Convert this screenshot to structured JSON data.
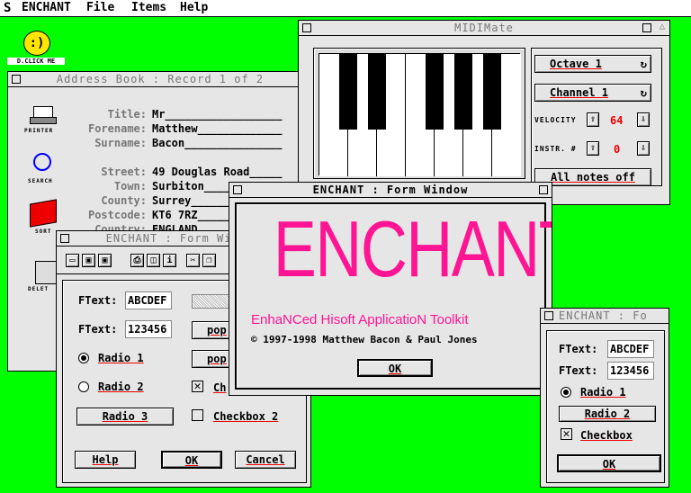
{
  "menubar": {
    "logo": "S",
    "app": "ENCHANT",
    "menus": [
      "File",
      "Items",
      "Help"
    ]
  },
  "desktop": {
    "dclick_label": "D.CLICK ME",
    "printer": "PRINTER",
    "search": "SEARCH",
    "sort": "SORT",
    "delete": "DELET"
  },
  "address_book": {
    "title": "Address Book : Record 1 of 2",
    "labels": [
      "Title:",
      "Forename:",
      "Surname:",
      "Street:",
      "Town:",
      "County:",
      "Postcode:",
      "Country:"
    ],
    "values": [
      "Mr__________________",
      "Matthew_____________",
      "Bacon_______________",
      "49 Douglas Road_____",
      "Surbiton____________",
      "Surrey______________",
      "KT6 7RZ_____________",
      "ENGLAND_____________"
    ]
  },
  "midimate": {
    "title": "MIDIMate",
    "octave": "Octave 1",
    "channel": "Channel 1",
    "velocity_label": "VELOCITY",
    "velocity": "64",
    "instr_label": "INSTR. #",
    "instr": "0",
    "all_notes": "All notes off"
  },
  "form_left": {
    "title": "ENCHANT : Form Window",
    "ftext_label": "FText:",
    "ftext1": "ABCDEF",
    "ftext2": "123456",
    "popup": "pop",
    "radio1": "Radio 1",
    "radio2": "Radio 2",
    "radio3": "Radio 3",
    "check1": "Ch",
    "check2": "Checkbox 2",
    "help": "Help",
    "ok": "OK",
    "cancel": "Cancel"
  },
  "about": {
    "title": "ENCHANT : Form Window",
    "logo": "ENCHANT",
    "subtitle": "EnhaNCed Hisoft ApplicatioN Toolkit",
    "copyright": "© 1997-1998 Matthew Bacon & Paul Jones",
    "ok": "OK",
    "accent": "#ff1493"
  },
  "form_right": {
    "title": "ENCHANT : Fo",
    "ftext_label": "FText:",
    "ftext1": "ABCDEF",
    "ftext2": "123456",
    "radio1": "Radio 1",
    "radio2": "Radio 2",
    "check": "Checkbox",
    "ok": "OK"
  }
}
